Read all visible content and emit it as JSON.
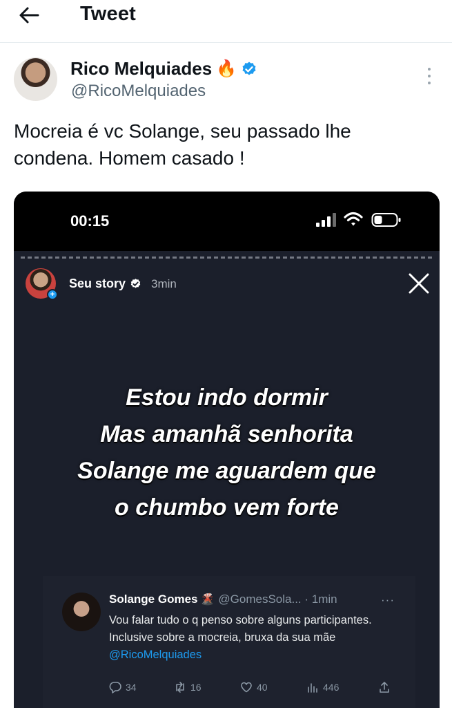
{
  "header": {
    "title": "Tweet"
  },
  "tweet": {
    "author_name": "Rico Melquiades",
    "author_emoji": "🔥",
    "author_handle": "@RicoMelquiades",
    "text": "Mocreia é vc Solange, seu passado lhe condena.  Homem casado !"
  },
  "media": {
    "status_time": "00:15",
    "story_label": "Seu story",
    "story_time": "3min",
    "story_lines": [
      "Estou indo dormir",
      "Mas amanhã senhorita",
      "Solange me aguardem que",
      "o chumbo vem forte"
    ],
    "quote": {
      "name": "Solange Gomes",
      "emoji": "🌋",
      "handle_time": "@GomesSola... · 1min",
      "text": "Vou falar tudo o q penso sobre alguns participantes. Inclusive sobre a mocreia, bruxa da sua mãe ",
      "mention": "@RicoMelquiades",
      "replies": "34",
      "retweets": "16",
      "likes": "40",
      "views": "446"
    }
  },
  "colors": {
    "accent": "#1d9bf0",
    "story_bg": "#1b1f2b",
    "text_primary": "#0f1419",
    "text_secondary": "#536471"
  },
  "icons": {
    "back": "arrow-left-icon",
    "verified": "verified-badge-icon",
    "more": "more-vertical-icon",
    "close": "close-icon"
  }
}
